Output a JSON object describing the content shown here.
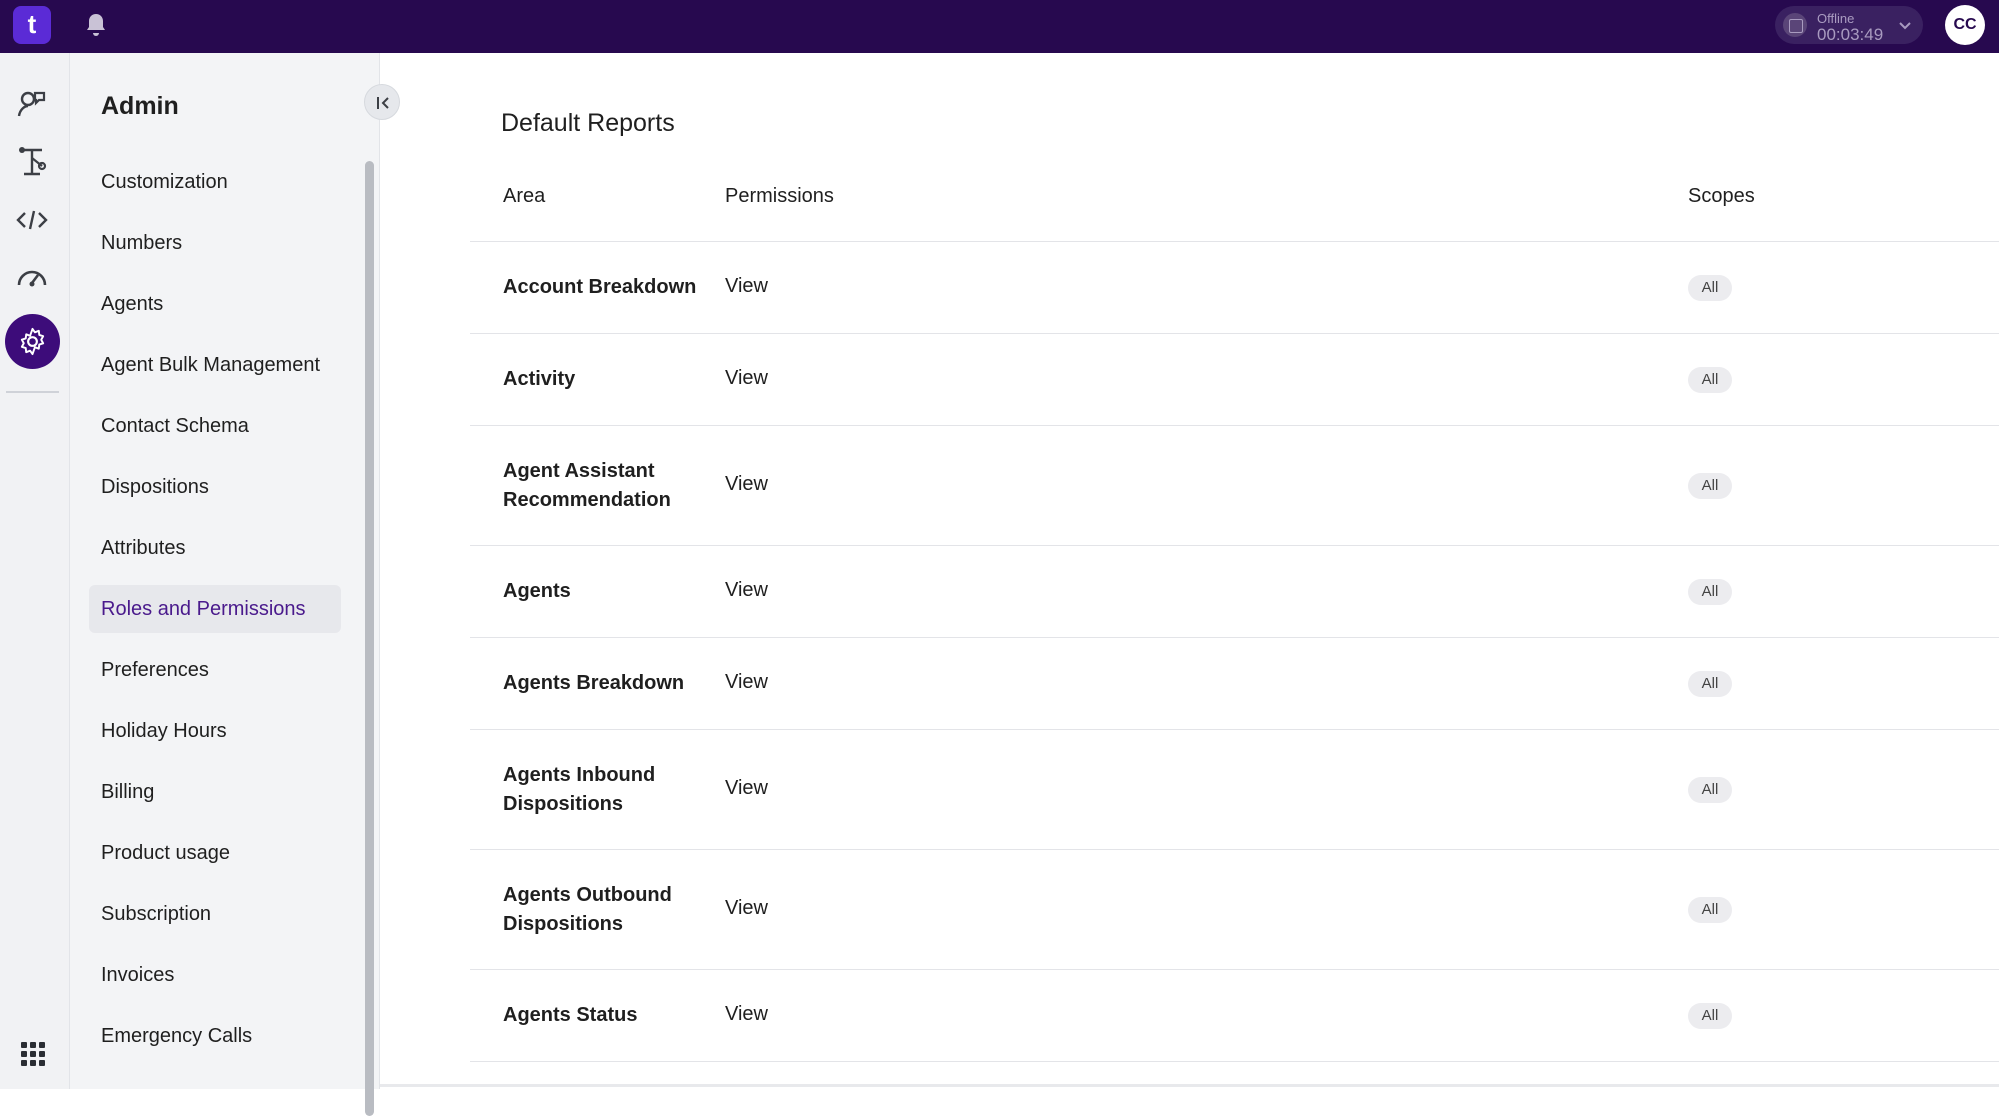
{
  "topbar": {
    "logo_text": "t",
    "bell_icon": "bell-icon",
    "status": {
      "label": "Offline",
      "timer": "00:03:49"
    },
    "avatar_initials": "CC",
    "colors": {
      "background": "#27094f",
      "logo": "#5b2bd6"
    }
  },
  "rail": {
    "icons": [
      "lightbulb-person-icon",
      "workflow-icon",
      "code-icon",
      "gauge-icon",
      "compass-icon",
      "settings-icon"
    ],
    "active": "settings-icon",
    "apps_icon": "apps-grid-icon"
  },
  "sidebar": {
    "title": "Admin",
    "items": [
      {
        "label": "Customization"
      },
      {
        "label": "Numbers"
      },
      {
        "label": "Agents"
      },
      {
        "label": "Agent Bulk Management"
      },
      {
        "label": "Contact Schema"
      },
      {
        "label": "Dispositions"
      },
      {
        "label": "Attributes"
      },
      {
        "label": "Roles and Permissions"
      },
      {
        "label": "Preferences"
      },
      {
        "label": "Holiday Hours"
      },
      {
        "label": "Billing"
      },
      {
        "label": "Product usage"
      },
      {
        "label": "Subscription"
      },
      {
        "label": "Invoices"
      },
      {
        "label": "Emergency Calls"
      }
    ],
    "active_item": "Roles and Permissions"
  },
  "main": {
    "section_title": "Default Reports",
    "columns": {
      "area": "Area",
      "permissions": "Permissions",
      "scopes": "Scopes"
    },
    "rows": [
      {
        "area": "Account Breakdown",
        "permission": "View",
        "scope": "All"
      },
      {
        "area": "Activity",
        "permission": "View",
        "scope": "All"
      },
      {
        "area": "Agent Assistant Recommendation",
        "permission": "View",
        "scope": "All"
      },
      {
        "area": "Agents",
        "permission": "View",
        "scope": "All"
      },
      {
        "area": "Agents Breakdown",
        "permission": "View",
        "scope": "All"
      },
      {
        "area": "Agents Inbound Dispositions",
        "permission": "View",
        "scope": "All"
      },
      {
        "area": "Agents Outbound Dispositions",
        "permission": "View",
        "scope": "All"
      },
      {
        "area": "Agents Status",
        "permission": "View",
        "scope": "All"
      }
    ]
  }
}
